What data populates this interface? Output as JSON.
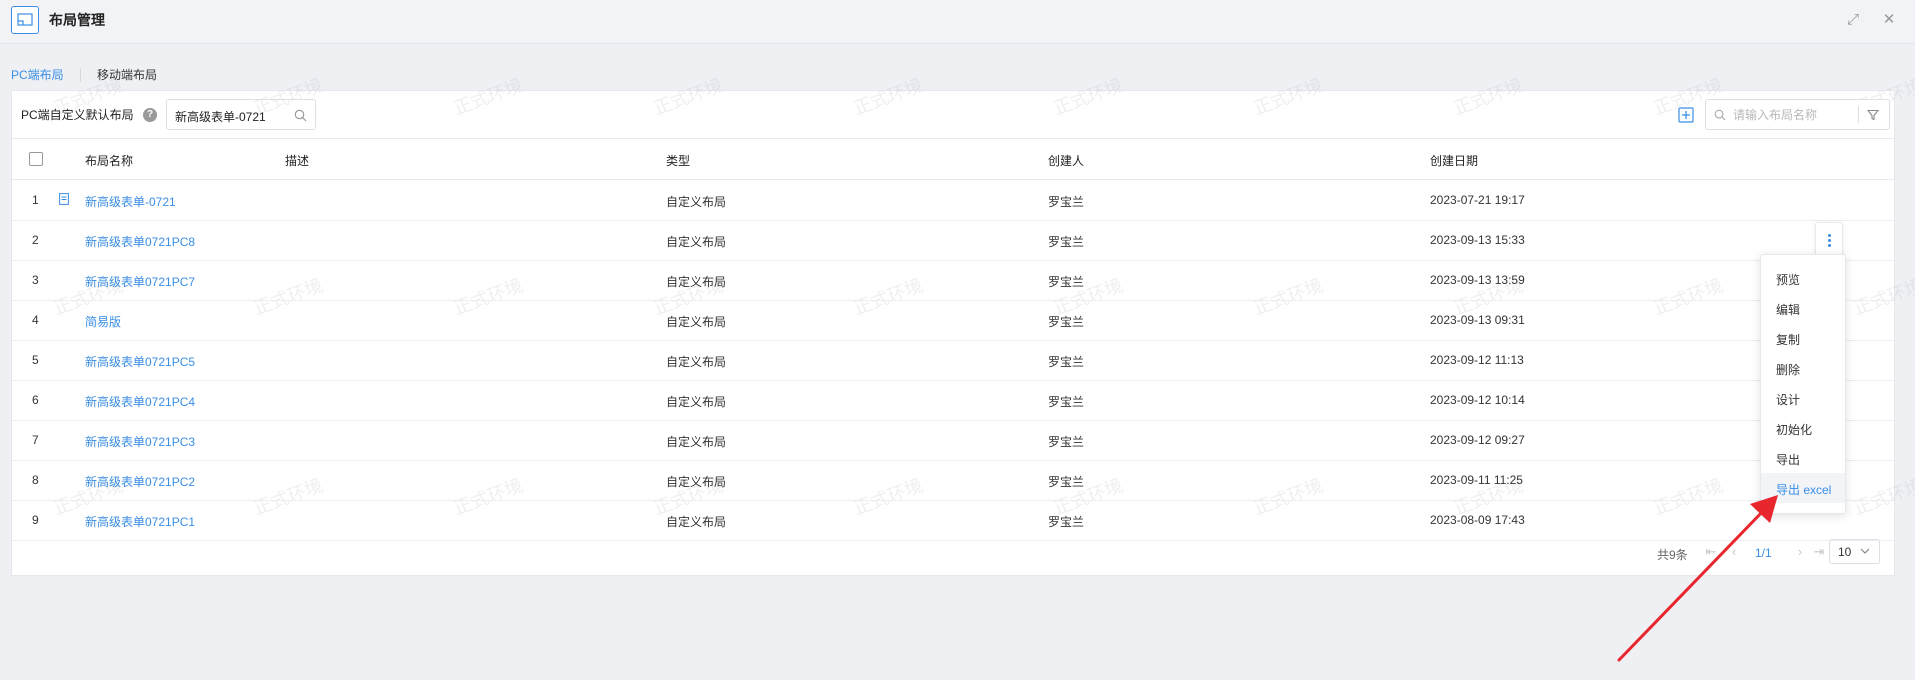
{
  "window": {
    "title": "布局管理",
    "expand_glyph": "⤢",
    "close_glyph": "✕"
  },
  "tabs": [
    {
      "label": "PC端布局",
      "active": true
    },
    {
      "label": "移动端布局",
      "active": false
    }
  ],
  "toolbar": {
    "label": "PC端自定义默认布局",
    "help_glyph": "?",
    "selected_layout": "新高级表单-0721",
    "search_placeholder": "请输入布局名称"
  },
  "table": {
    "columns": [
      "布局名称",
      "描述",
      "类型",
      "创建人",
      "创建日期"
    ],
    "rows": [
      {
        "index": "1",
        "name": "新高级表单-0721",
        "type": "自定义布局",
        "creator": "罗宝兰",
        "date": "2023-07-21 19:17",
        "default": true
      },
      {
        "index": "2",
        "name": "新高级表单0721PC8",
        "type": "自定义布局",
        "creator": "罗宝兰",
        "date": "2023-09-13 15:33"
      },
      {
        "index": "3",
        "name": "新高级表单0721PC7",
        "type": "自定义布局",
        "creator": "罗宝兰",
        "date": "2023-09-13 13:59"
      },
      {
        "index": "4",
        "name": "简易版",
        "type": "自定义布局",
        "creator": "罗宝兰",
        "date": "2023-09-13 09:31"
      },
      {
        "index": "5",
        "name": "新高级表单0721PC5",
        "type": "自定义布局",
        "creator": "罗宝兰",
        "date": "2023-09-12 11:13"
      },
      {
        "index": "6",
        "name": "新高级表单0721PC4",
        "type": "自定义布局",
        "creator": "罗宝兰",
        "date": "2023-09-12 10:14"
      },
      {
        "index": "7",
        "name": "新高级表单0721PC3",
        "type": "自定义布局",
        "creator": "罗宝兰",
        "date": "2023-09-12 09:27"
      },
      {
        "index": "8",
        "name": "新高级表单0721PC2",
        "type": "自定义布局",
        "creator": "罗宝兰",
        "date": "2023-09-11 11:25"
      },
      {
        "index": "9",
        "name": "新高级表单0721PC1",
        "type": "自定义布局",
        "creator": "罗宝兰",
        "date": "2023-08-09 17:43"
      }
    ]
  },
  "context_menu": {
    "items": [
      {
        "label": "预览"
      },
      {
        "label": "编辑"
      },
      {
        "label": "复制"
      },
      {
        "label": "删除"
      },
      {
        "label": "设计"
      },
      {
        "label": "初始化"
      },
      {
        "label": "导出"
      },
      {
        "label": "导出 excel",
        "highlighted": true
      }
    ]
  },
  "pagination": {
    "total": "共9条",
    "first_glyph": "⇤",
    "prev_glyph": "‹",
    "page": "1/1",
    "next_glyph": "›",
    "last_glyph": "⇥",
    "page_size": "10"
  },
  "watermark": "正式环境",
  "colors": {
    "accent": "#3a8ee6",
    "annotation_arrow": "#e8262d",
    "background": "#eef0f4"
  },
  "icons": {
    "app": "layout-icon",
    "help": "question-circle-icon",
    "search": "search-icon",
    "add": "plus-square-icon",
    "filter": "filter-icon",
    "more": "more-vertical-icon",
    "default_layout": "document-icon",
    "page_size_dropdown": "chevron-down-icon"
  }
}
